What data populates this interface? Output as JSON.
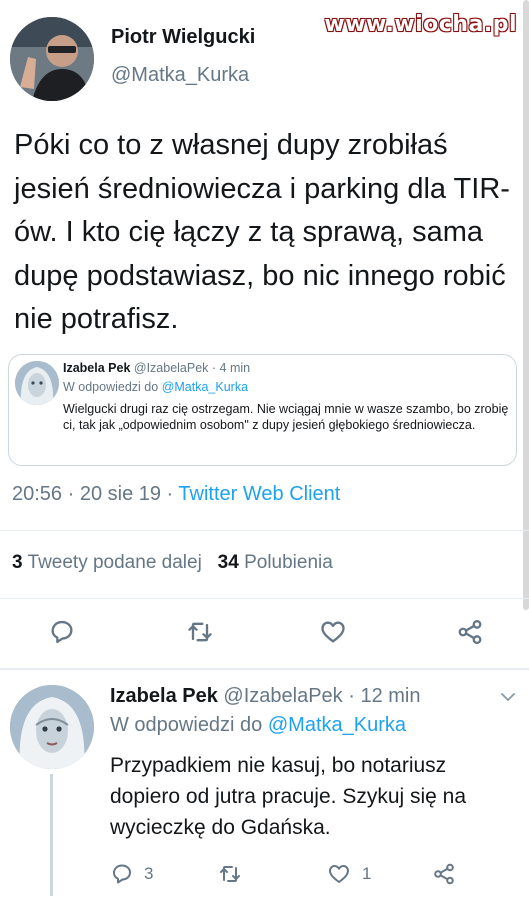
{
  "watermark": "www.wiocha.pl",
  "main_tweet": {
    "author_name": "Piotr Wielgucki",
    "author_handle": "@Matka_Kurka",
    "text": "Póki co to z własnej dupy zrobiłaś jesień średniowiecza i parking dla TIR-ów. I kto cię łączy z tą sprawą, sama dupę podstawiasz, bo nic innego robić nie potrafisz.",
    "quoted": {
      "author_name": "Izabela Pek",
      "author_handle": "@IzabelaPek",
      "time": "· 4 min",
      "reply_prefix": "W odpowiedzi do",
      "reply_to": "@Matka_Kurka",
      "text": "Wielgucki drugi raz cię ostrzegam. Nie wciągaj mnie w wasze szambo, bo zrobię ci, tak jak „odpowiednim osobom\" z dupy jesień głębokiego średniowiecza."
    },
    "timestamp": "20:56 · 20 sie 19 ·",
    "client": "Twitter Web Client",
    "retweets_count": "3",
    "retweets_label": "Tweety podane dalej",
    "likes_count": "34",
    "likes_label": "Polubienia"
  },
  "reply_tweet": {
    "author_name": "Izabela Pek",
    "author_handle": "@IzabelaPek",
    "time": "· 12 min",
    "reply_prefix": "W odpowiedzi do",
    "reply_to": "@Matka_Kurka",
    "text": "Przypadkiem nie kasuj, bo notariusz dopiero od jutra pracuje. Szykuj się na wycieczkę do Gdańska.",
    "reply_count": "3",
    "like_count": "1"
  },
  "icons": [
    "reply-icon",
    "retweet-icon",
    "like-icon",
    "share-icon",
    "chevron-down-icon"
  ],
  "colors": {
    "link": "#1da1f2",
    "secondary_text": "#657786",
    "divider": "#e6ecf0"
  }
}
